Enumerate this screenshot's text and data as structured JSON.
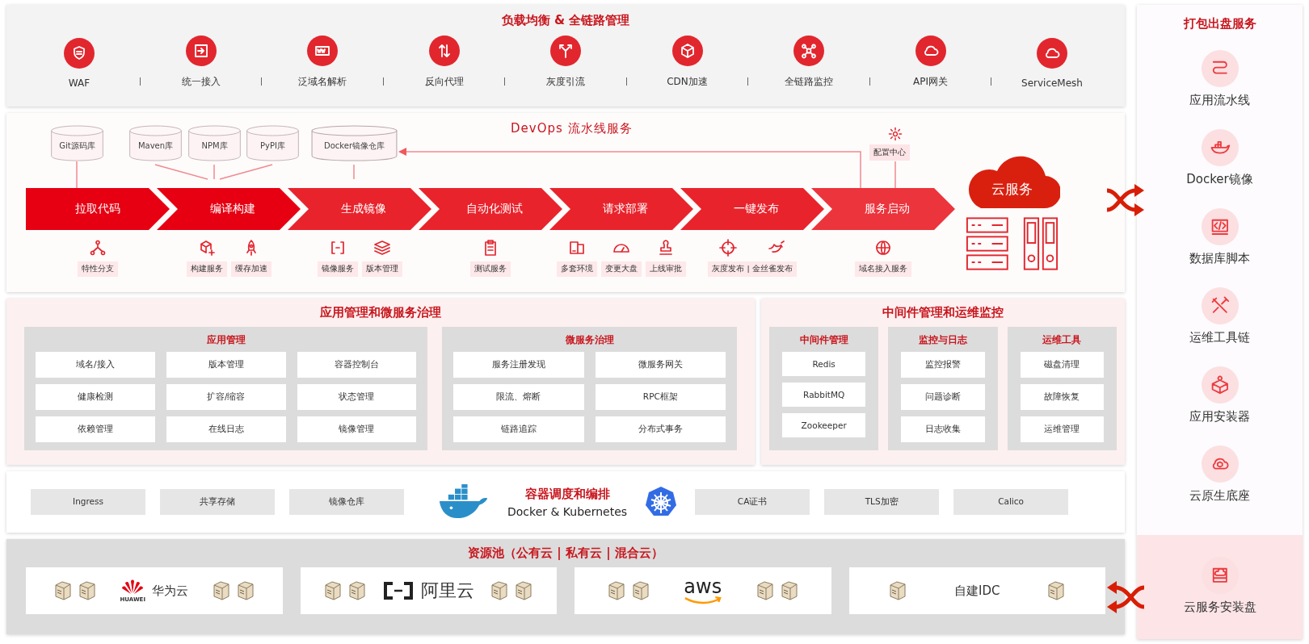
{
  "load_balancing": {
    "title": "负载均衡 & 全链路管理",
    "items": [
      {
        "label": "WAF"
      },
      {
        "label": "统一接入"
      },
      {
        "label": "泛域名解析"
      },
      {
        "label": "反向代理"
      },
      {
        "label": "灰度引流"
      },
      {
        "label": "CDN加速"
      },
      {
        "label": "全链路监控"
      },
      {
        "label": "API网关"
      },
      {
        "label": "ServiceMesh"
      }
    ]
  },
  "devops": {
    "title": "DevOps 流水线服务",
    "repositories": [
      {
        "label": "Git源码库"
      },
      {
        "label": "Maven库"
      },
      {
        "label": "NPM库"
      },
      {
        "label": "PyPI库"
      },
      {
        "label": "Docker镜像仓库"
      }
    ],
    "config_center": "配置中心",
    "cloud_label": "云服务",
    "stages": [
      {
        "label": "拉取代码",
        "tools": [
          {
            "label": "特性分支"
          }
        ]
      },
      {
        "label": "编译构建",
        "tools": [
          {
            "label": "构建服务"
          },
          {
            "label": "缓存加速"
          }
        ]
      },
      {
        "label": "生成镜像",
        "tools": [
          {
            "label": "镜像服务"
          },
          {
            "label": "版本管理"
          }
        ]
      },
      {
        "label": "自动化测试",
        "tools": [
          {
            "label": "测试服务"
          }
        ]
      },
      {
        "label": "请求部署",
        "tools": [
          {
            "label": "多套环境"
          },
          {
            "label": "变更大盘"
          },
          {
            "label": "上线审批"
          }
        ]
      },
      {
        "label": "一键发布",
        "tools": [
          {
            "label": "灰度发布 | 金丝雀发布"
          }
        ]
      },
      {
        "label": "服务启动",
        "tools": [
          {
            "label": "域名接入服务"
          }
        ]
      }
    ]
  },
  "app_governance": {
    "title": "应用管理和微服务治理",
    "panels": [
      {
        "title": "应用管理",
        "items": [
          "域名/接入",
          "版本管理",
          "容器控制台",
          "健康检测",
          "扩容/缩容",
          "状态管理",
          "依赖管理",
          "在线日志",
          "镜像管理"
        ]
      },
      {
        "title": "微服务治理",
        "items": [
          "服务注册发现",
          "微服务网关",
          "限流、熔断",
          "RPC框架",
          "链路追踪",
          "分布式事务"
        ]
      }
    ]
  },
  "middleware": {
    "title": "中间件管理和运维监控",
    "panels": [
      {
        "title": "中间件管理",
        "items": [
          "Redis",
          "RabbitMQ",
          "Zookeeper"
        ]
      },
      {
        "title": "监控与日志",
        "items": [
          "监控报警",
          "问题诊断",
          "日志收集"
        ]
      },
      {
        "title": "运维工具",
        "items": [
          "磁盘清理",
          "故障恢复",
          "运维管理"
        ]
      }
    ]
  },
  "container": {
    "title": "容器调度和编排",
    "subtitle": "Docker & Kubernetes",
    "left_items": [
      "Ingress",
      "共享存储",
      "镜像仓库"
    ],
    "right_items": [
      "CA证书",
      "TLS加密",
      "Calico"
    ]
  },
  "resource_pool": {
    "title": "资源池（公有云 | 私有云 | 混合云）",
    "providers": [
      {
        "kind": "huawei",
        "label": "华为云",
        "logo_text": "HUAWEI"
      },
      {
        "kind": "aliyun",
        "label": "阿里云"
      },
      {
        "kind": "aws",
        "label": "aws"
      },
      {
        "kind": "idc",
        "label": "自建IDC"
      }
    ]
  },
  "package_service": {
    "title": "打包出盘服务",
    "items": [
      {
        "label": "应用流水线",
        "highlighted": false
      },
      {
        "label": "Docker镜像",
        "highlighted": false
      },
      {
        "label": "数据库脚本",
        "highlighted": false
      },
      {
        "label": "运维工具链",
        "highlighted": false
      },
      {
        "label": "应用安装器",
        "highlighted": false
      },
      {
        "label": "云原生底座",
        "highlighted": false
      },
      {
        "label": "云服务安装盘",
        "highlighted": true
      }
    ]
  }
}
